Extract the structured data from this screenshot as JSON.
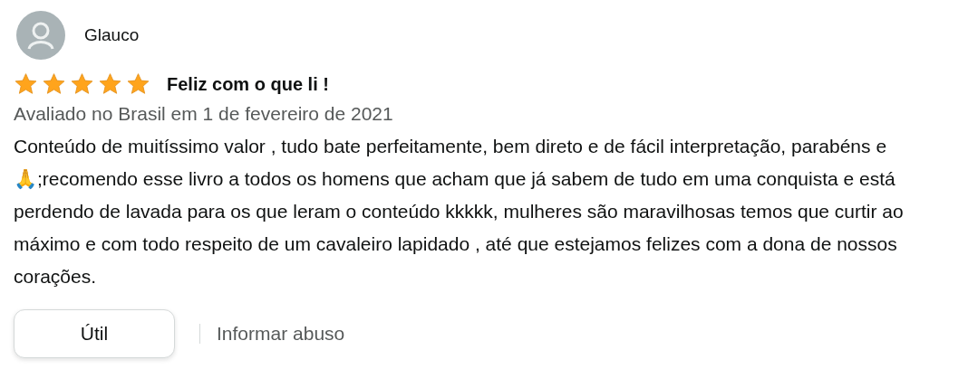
{
  "review": {
    "author": "Glauco",
    "stars": 5,
    "title": "Feliz com o que li !",
    "date": "Avaliado no Brasil em 1 de fevereiro de 2021",
    "body": "Conteúdo de muitíssimo valor , tudo bate perfeitamente, bem direto e de fácil interpretação, parabéns e 🙏;recomendo esse livro a todos os homens que acham que já sabem de tudo em uma conquista e está perdendo de lavada para os que leram o conteúdo kkkkk, mulheres são maravilhosas temos que curtir ao máximo e com todo respeito de um cavaleiro lapidado , até que estejamos felizes com a dona de nossos corações.",
    "helpful_button": "Útil",
    "report_link": "Informar abuso"
  }
}
